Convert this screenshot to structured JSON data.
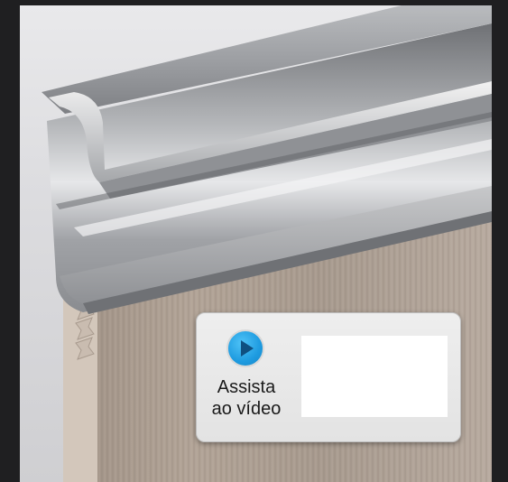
{
  "video_card": {
    "line1": "Assista",
    "line2": "ao vídeo"
  },
  "icons": {
    "play": "play-icon"
  },
  "colors": {
    "background": "#1f1f21",
    "play_button": "#1e9be0",
    "card": "#ebebeb"
  }
}
